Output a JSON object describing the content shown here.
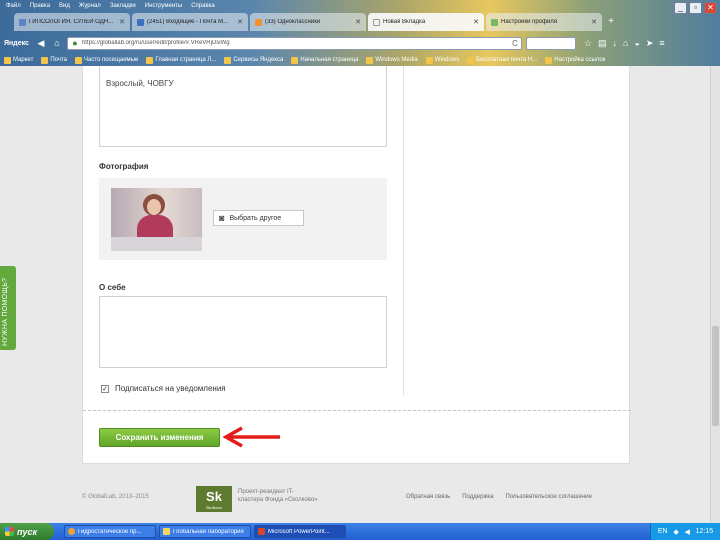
{
  "menubar": [
    "Файл",
    "Правка",
    "Вид",
    "Журнал",
    "Закладки",
    "Инструменты",
    "Справка"
  ],
  "tabs": [
    {
      "title": "ГИПСОЛОГИЯ. СУЛЕЙ ОДН...",
      "color": "#5b83c9",
      "active": false
    },
    {
      "title": "(2451) Входящие - Почта М...",
      "color": "#3b6fc1",
      "active": false
    },
    {
      "title": "(33) Одноклассники",
      "color": "#f1902c",
      "active": false
    },
    {
      "title": "Новая Вкладка",
      "color": "#f4f4f4",
      "active": true
    },
    {
      "title": "Настройки профиля",
      "color": "#7bb661",
      "active": false
    }
  ],
  "nav": {
    "brand": "Яндекс",
    "url": "https://globallab.org/ru/user/edit/profile/#.VReVRjDsiWg",
    "reload": "C"
  },
  "bookmarks": [
    "Маркет",
    "Почта",
    "Часто посещаемые",
    "Главная страница Л...",
    "Сервисы Яндекса",
    "Начальная страница",
    "Windows Media",
    "Windows",
    "Бесплатная почта H...",
    "Настройка ссылок"
  ],
  "form": {
    "education_value": "Взрослый, ЧОВГУ",
    "photo_label": "Фотография",
    "choose_button": "Выбрать другое",
    "about_label": "О себе",
    "subscribe_label": "Подписаться на уведомления",
    "save_button": "Сохранить изменения"
  },
  "help_tab": "НУЖНА ПОМОЩЬ?",
  "footer": {
    "copyright": "© GlobalLab, 2013–2015",
    "project_text": "Проект-резидент IT-кластера Фонда «Сколково»",
    "sk_logo": "Sk",
    "sk_small": "Skolkovo",
    "links": [
      "Обратная связь",
      "Поддержка",
      "Пользовательское соглашение"
    ]
  },
  "taskbar": {
    "start": "пуск",
    "tasks": [
      {
        "label": "Гидростатическое пр...",
        "active": false
      },
      {
        "label": "Глобальная лаборатория",
        "active": false
      },
      {
        "label": "Microsoft PowerPoint...",
        "active": true
      }
    ],
    "clock": "12:15",
    "lang": "EN"
  }
}
